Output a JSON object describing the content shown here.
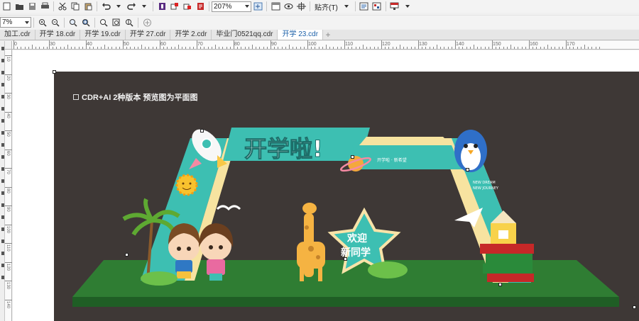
{
  "toolbar": {
    "zoom_value": "207%",
    "paste_menu": "贴齐(T)",
    "icons": [
      "new-icon",
      "open-icon",
      "save-icon",
      "print-icon",
      "cut-icon",
      "copy-icon",
      "paste-icon",
      "undo-icon",
      "redo-icon",
      "search-content-icon",
      "import-icon",
      "export-icon",
      "publish-icon",
      "zoom-icon",
      "fullscreen-icon",
      "wireframe-icon",
      "view-icon",
      "guides-icon",
      "options-icon",
      "app-launcher-icon",
      "welcome-icon"
    ]
  },
  "property_bar": {
    "unit_value": "7%"
  },
  "tabs": [
    {
      "label": "加工.cdr",
      "active": false
    },
    {
      "label": "开学 18.cdr",
      "active": false
    },
    {
      "label": "开学 19.cdr",
      "active": false
    },
    {
      "label": "开学 27.cdr",
      "active": false
    },
    {
      "label": "开学 2.cdr",
      "active": false
    },
    {
      "label": "毕业门0521qq.cdr",
      "active": false
    },
    {
      "label": "开学 23.cdr",
      "active": true
    }
  ],
  "ruler": {
    "h_labels": [
      "0",
      "30",
      "40",
      "50",
      "60",
      "70",
      "80",
      "90",
      "100",
      "110",
      "120",
      "130",
      "140",
      "150",
      "160",
      "170"
    ],
    "v_labels": [
      "10",
      "20",
      "30",
      "40",
      "50",
      "60",
      "70",
      "80",
      "90",
      "100",
      "110",
      "120",
      "130",
      "140"
    ]
  },
  "artwork": {
    "caption": "CDR+AI 2种版本  预览图为平面图",
    "main_title": "开学啦!",
    "slogan": "开学啦 · 新希望",
    "side_text_1": "NEW DREAM",
    "side_text_2": "NEW JOURNEY",
    "star_text_1": "欢迎",
    "star_text_2": "新同学",
    "colors": {
      "background": "#3e3836",
      "arch_teal": "#3dbfb2",
      "arch_cream": "#f7e3a0",
      "floor_green": "#2f7d33",
      "floor_dark": "#1f5e25"
    }
  }
}
